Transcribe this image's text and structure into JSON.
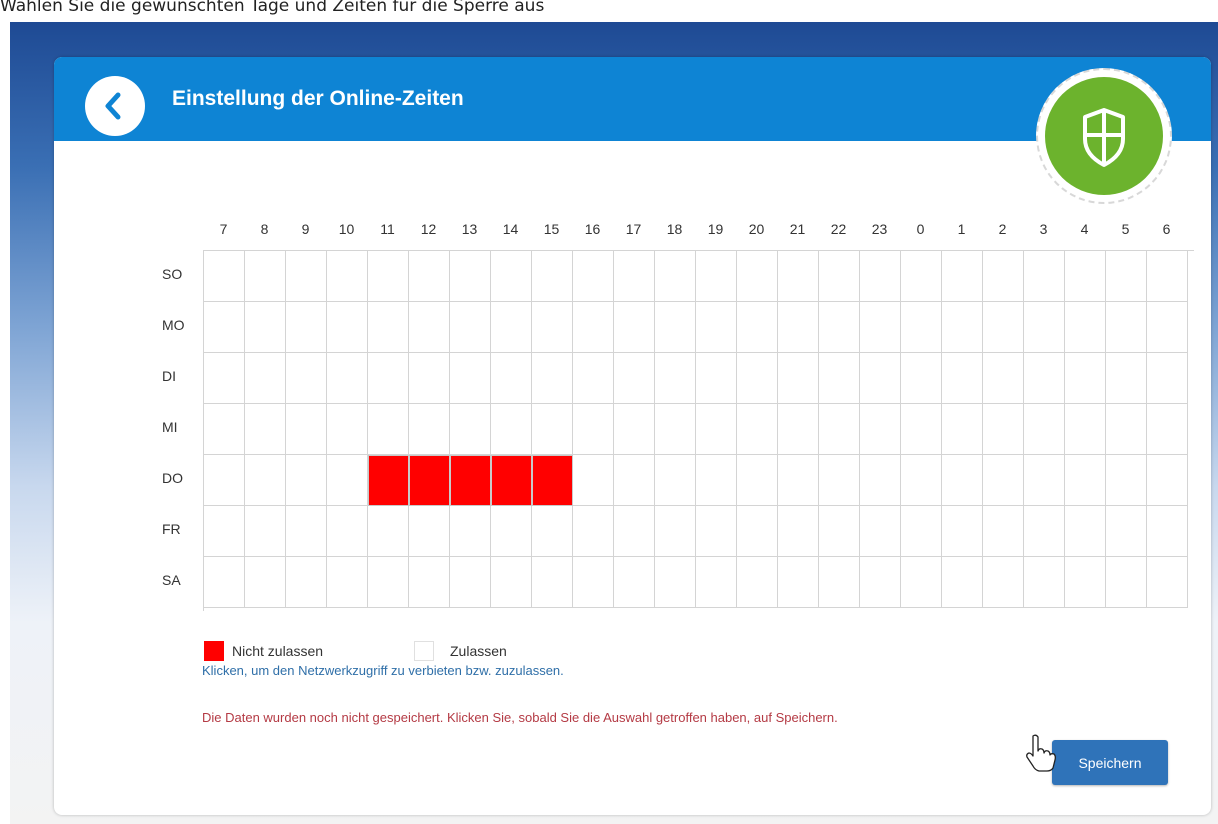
{
  "caption": "Wählen Sie die gewünschten Tage und Zeiten für die Sperre aus",
  "header": {
    "title": "Einstellung der Online-Zeiten"
  },
  "icons": {
    "back": "chevron-left-icon",
    "shield": "shield-icon",
    "cursor": "hand-pointer-icon"
  },
  "schedule": {
    "hours": [
      "7",
      "8",
      "9",
      "10",
      "11",
      "12",
      "13",
      "14",
      "15",
      "16",
      "17",
      "18",
      "19",
      "20",
      "21",
      "22",
      "23",
      "0",
      "1",
      "2",
      "3",
      "4",
      "5",
      "6"
    ],
    "days": [
      "SO",
      "MO",
      "DI",
      "MI",
      "DO",
      "FR",
      "SA"
    ],
    "blocked": {
      "DO": [
        "11",
        "12",
        "13",
        "14",
        "15"
      ]
    }
  },
  "legend": {
    "blocked_label": "Nicht zulassen",
    "allowed_label": "Zulassen"
  },
  "hint": "Klicken, um den Netzwerkzugriff zu verbieten bzw. zuzulassen.",
  "warning": "Die Daten wurden noch nicht gespeichert. Klicken Sie, sobald Sie die Auswahl getroffen haben, auf Speichern.",
  "save_label": "Speichern",
  "colors": {
    "header": "#0e84d4",
    "blocked": "#ff0000",
    "shield_badge": "#6cb32d",
    "save_button": "#2f73b9",
    "warning_text": "#b43a44",
    "hint_text": "#2f6fa8"
  }
}
